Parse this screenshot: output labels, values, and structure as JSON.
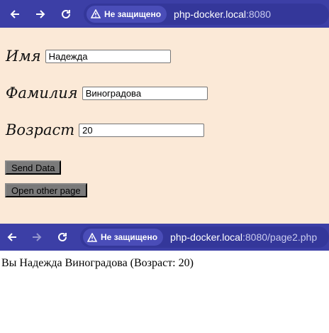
{
  "browser_top": {
    "security_label": "Не защищено",
    "url_host": "php-docker.local",
    "url_rest": ":8080"
  },
  "form": {
    "first_name": {
      "label": "Имя",
      "value": "Надежда"
    },
    "last_name": {
      "label": "Фамилия",
      "value": "Виноградова"
    },
    "age": {
      "label": "Возраст",
      "value": "20"
    },
    "send_button": "Send Data",
    "open_button": "Open other page"
  },
  "browser_bottom": {
    "security_label": "Не защищено",
    "url_host": "php-docker.local",
    "url_rest": ":8080/page2.php"
  },
  "result": {
    "text": "Вы Надежда Виноградова (Возраст: 20)"
  },
  "colors": {
    "toolbar": "#3c3fa6",
    "form_background": "#fbe9d7",
    "button": "#7a7a7a"
  },
  "icons": [
    "back-arrow-icon",
    "forward-arrow-icon",
    "reload-icon",
    "warning-triangle-icon"
  ]
}
